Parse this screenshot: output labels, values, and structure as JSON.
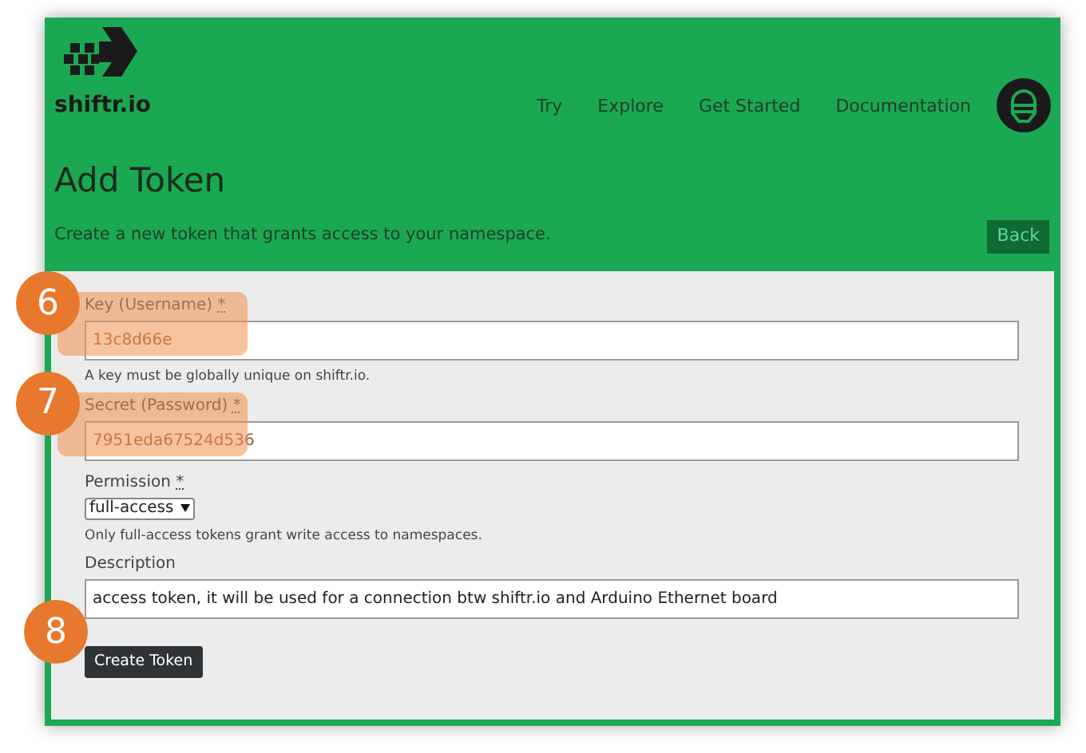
{
  "header": {
    "brand": "shiftr.io",
    "nav": [
      "Try",
      "Explore",
      "Get Started",
      "Documentation"
    ]
  },
  "page": {
    "title": "Add Token",
    "subtitle": "Create a new token that grants access to your namespace.",
    "back": "Back"
  },
  "form": {
    "fields": [
      {
        "kind": "text",
        "label": "Key (Username)",
        "required_mark": "*",
        "value": "13c8d66e",
        "help": "A key must be globally unique on shiftr.io.",
        "highlighted": true
      },
      {
        "kind": "text",
        "label": "Secret (Password)",
        "required_mark": "*",
        "value": "7951eda67524d536",
        "highlighted": true
      },
      {
        "kind": "select",
        "label": "Permission",
        "required_mark": "*",
        "value": "full-access",
        "help": "Only full-access tokens grant write access to namespaces.",
        "highlighted": false
      },
      {
        "kind": "text",
        "label": "Description",
        "value": "access token, it will be used for a connection btw shiftr.io and Arduino Ethernet board",
        "highlighted": false
      }
    ],
    "submit": "Create Token"
  },
  "callouts": [
    "6",
    "7",
    "8"
  ]
}
